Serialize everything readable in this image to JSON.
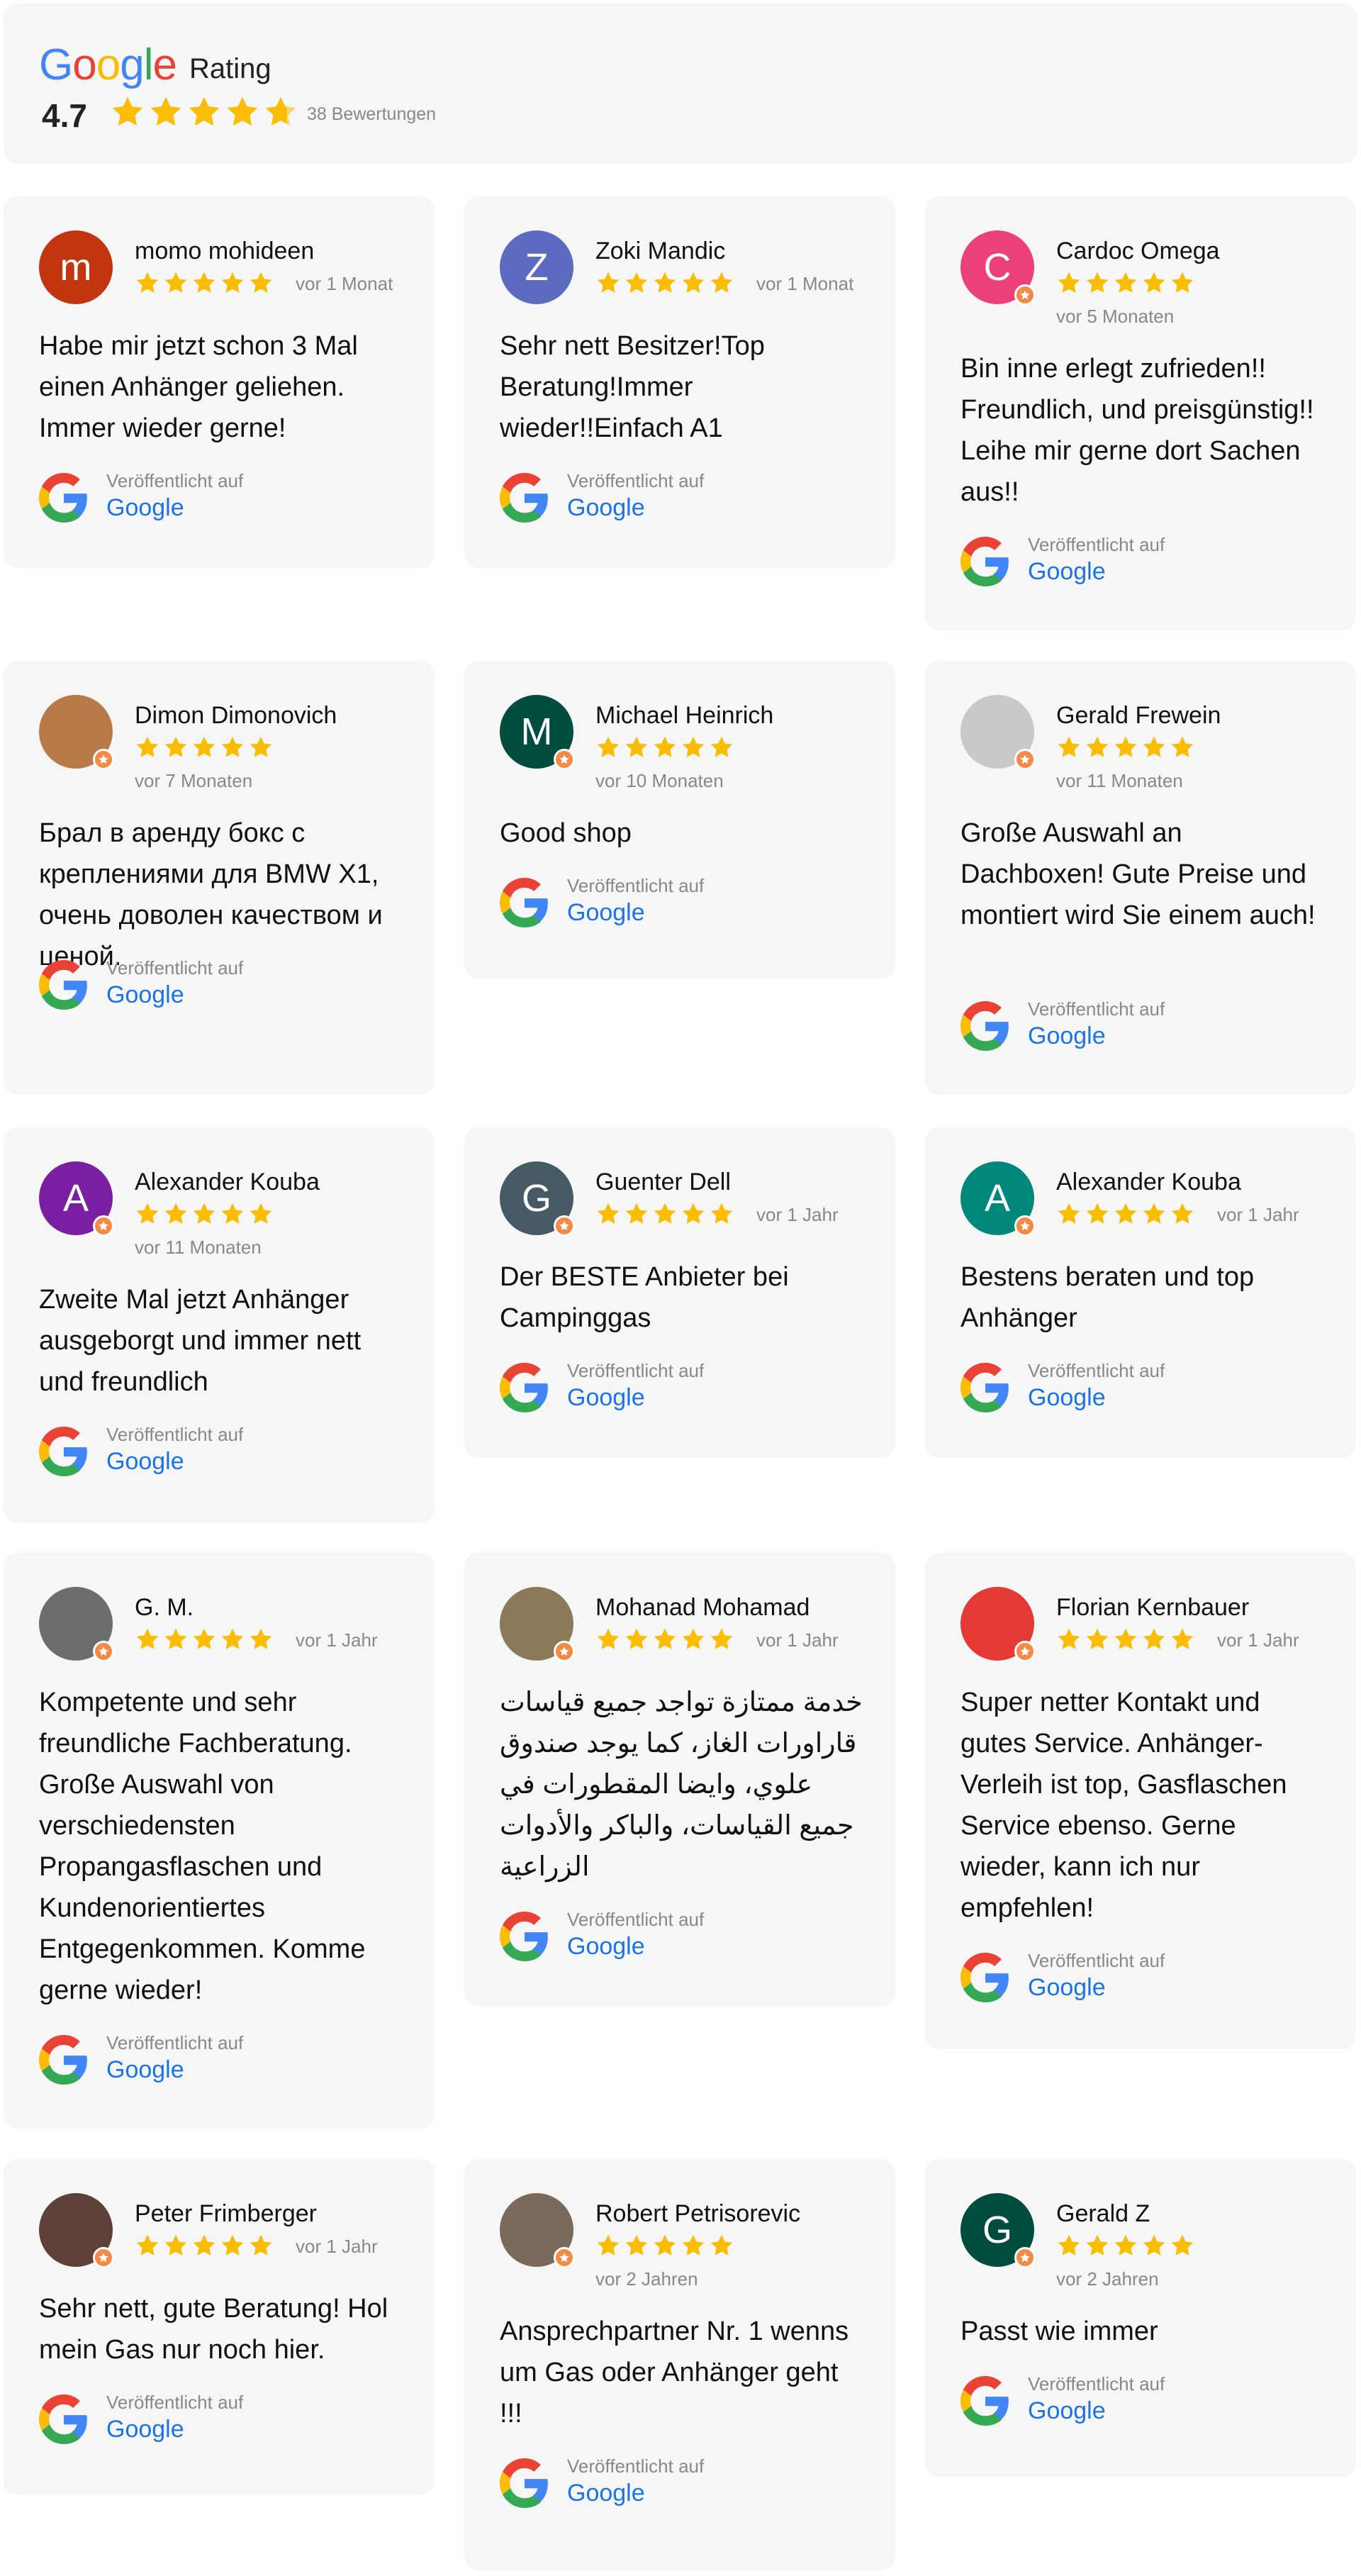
{
  "header": {
    "logo_text": "Google",
    "title": "Rating",
    "score": "4.7",
    "count": "38 Bewertungen",
    "stars": 4.7
  },
  "colors": {
    "star": "#fbbc04",
    "link": "#1a73e8",
    "card_bg": "#f6f6f6",
    "muted": "#888888",
    "badge": "#f48a45"
  },
  "published_label": "Veröffentlicht auf",
  "published_link": "Google",
  "reviews": [
    {
      "name": "momo mohideen",
      "date": "vor 1 Monat",
      "text": "Habe mir jetzt schon 3 Mal einen Anhänger geliehen. Immer wieder gerne!",
      "initial": "m",
      "avatar_color": "#c1360f",
      "rating": 5
    },
    {
      "name": "Zoki Mandic",
      "date": "vor 1 Monat",
      "text": "Sehr nett Besitzer!Top Beratung!Immer wieder!!Einfach A1",
      "initial": "Z",
      "avatar_color": "#5c6bc0",
      "rating": 5
    },
    {
      "name": "Cardoc Omega",
      "date": "vor 5 Monaten",
      "text": "Bin inne erlegt zufrieden!! Freundlich, und preisgünstig!! Leihe mir gerne dort Sachen aus!!",
      "initial": "C",
      "avatar_color": "#ec407a",
      "rating": 5
    },
    {
      "name": "Dimon Dimonovich",
      "date": "vor 7 Monaten",
      "text": "Брал в аренду бокс с креплениями для BMW X1, очень доволен качеством и ценой.",
      "initial": "",
      "avatar_color": "#b97a4a",
      "rating": 5
    },
    {
      "name": "Michael Heinrich",
      "date": "vor 10 Monaten",
      "text": "Good shop",
      "initial": "M",
      "avatar_color": "#004d40",
      "rating": 5
    },
    {
      "name": "Gerald Frewein",
      "date": "vor 11 Monaten",
      "text": "Große Auswahl an Dachboxen! Gute Preise und montiert wird Sie einem auch!",
      "initial": "",
      "avatar_color": "#c9c9c9",
      "rating": 5
    },
    {
      "name": "Alexander Kouba",
      "date": "vor 11 Monaten",
      "text": "Zweite Mal jetzt Anhänger ausgeborgt und immer nett und freundlich",
      "initial": "A",
      "avatar_color": "#7b1fa2",
      "rating": 5
    },
    {
      "name": "Guenter Dell",
      "date": "vor 1 Jahr",
      "text": "Der BESTE Anbieter bei Campinggas",
      "initial": "G",
      "avatar_color": "#455a64",
      "rating": 5
    },
    {
      "name": "Alexander Kouba",
      "date": "vor 1 Jahr",
      "text": "Bestens beraten und top Anhänger",
      "initial": "A",
      "avatar_color": "#00897b",
      "rating": 5
    },
    {
      "name": "G. M.",
      "date": "vor 1 Jahr",
      "text": "Kompetente und sehr freundliche Fachberatung. Große Auswahl von verschiedensten Propangasflaschen und Kundenorientiertes Entgegenkommen. Komme gerne wieder!",
      "initial": "",
      "avatar_color": "#6d6d6d",
      "rating": 5
    },
    {
      "name": "Mohanad Mohamad",
      "date": "vor 1 Jahr",
      "text": "خدمة ممتازة تواجد جميع قياسات قاراورات الغاز، كما يوجد صندوق علوي، وايضا المقطورات في جميع القياسات، والباكر والأدوات الزراعية",
      "initial": "",
      "avatar_color": "#8a7a5a",
      "rating": 5
    },
    {
      "name": "Florian Kernbauer",
      "date": "vor 1 Jahr",
      "text": "Super netter Kontakt und gutes Service. Anhänger-Verleih ist top, Gasflaschen Service ebenso. Gerne wieder, kann ich nur empfehlen!",
      "initial": "",
      "avatar_color": "#e53935",
      "rating": 5
    },
    {
      "name": "Peter Frimberger",
      "date": "vor 1 Jahr",
      "text": "Sehr nett, gute Beratung! Hol mein Gas nur noch hier.",
      "initial": "",
      "avatar_color": "#5d4037",
      "rating": 5
    },
    {
      "name": "Robert Petrisorevic",
      "date": "vor 2 Jahren",
      "text": "Ansprechpartner Nr. 1 wenns um Gas oder Anhänger geht !!!",
      "initial": "",
      "avatar_color": "#7a6a5a",
      "rating": 5
    },
    {
      "name": "Gerald Z",
      "date": "vor 2 Jahren",
      "text": "Passt wie immer",
      "initial": "G",
      "avatar_color": "#004d40",
      "rating": 5
    }
  ]
}
